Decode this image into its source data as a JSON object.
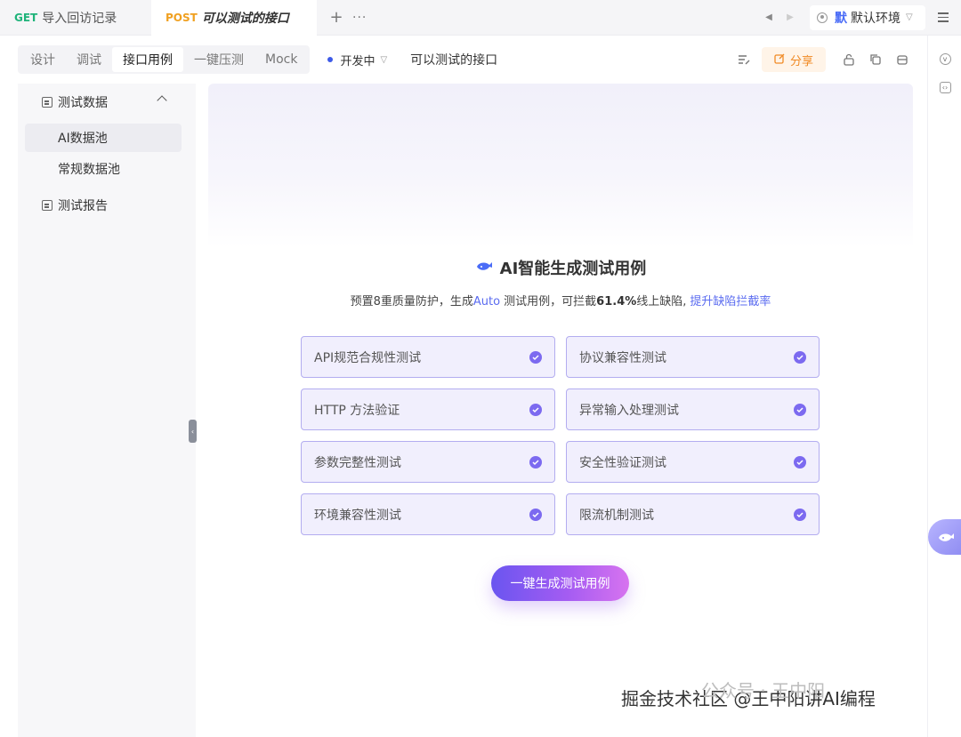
{
  "tabs": [
    {
      "method": "GET",
      "name": "导入回访记录"
    },
    {
      "method": "POST",
      "name": "可以测试的接口"
    }
  ],
  "tabbar": {
    "plus": "+",
    "more": "···"
  },
  "environment": {
    "badge": "默",
    "name": "默认环境"
  },
  "toolbar": {
    "segments": [
      "设计",
      "调试",
      "接口用例",
      "一键压测",
      "Mock"
    ],
    "active_segment": "接口用例",
    "status": "开发中",
    "api_name": "可以测试的接口",
    "share_label": "分享"
  },
  "sidebar": {
    "groups": [
      {
        "label": "测试数据",
        "expanded": true,
        "items": [
          "AI数据池",
          "常规数据池"
        ],
        "active_item": "AI数据池"
      },
      {
        "label": "测试报告"
      }
    ]
  },
  "main": {
    "title": "AI智能生成测试用例",
    "subtitle_prefix": "预置8重质量防护，生成",
    "subtitle_auto": "Auto",
    "subtitle_middle": " 测试用例，可拦截",
    "subtitle_percent": "61.4%",
    "subtitle_suffix": "线上缺陷,",
    "subtitle_link": "提升缺陷拦截率",
    "cards": [
      "API规范合规性测试",
      "协议兼容性测试",
      "HTTP 方法验证",
      "异常输入处理测试",
      "参数完整性测试",
      "安全性验证测试",
      "环境兼容性测试",
      "限流机制测试"
    ],
    "generate_button": "一键生成测试用例"
  },
  "watermark": {
    "main": "掘金技术社区 @王中阳讲AI编程",
    "ghost": "公众号 · 王中阳"
  },
  "colors": {
    "accent": "#7c6af0",
    "share": "#f08a24",
    "get": "#1fb37a",
    "post": "#f0a020"
  },
  "icons": {
    "title": "whale-icon",
    "float": "whale-icon"
  }
}
